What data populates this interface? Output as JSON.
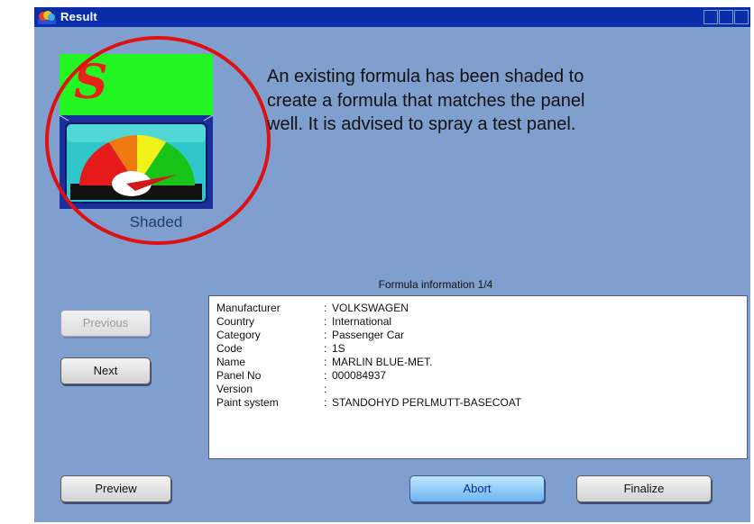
{
  "window": {
    "title": "Result"
  },
  "status": {
    "letter": "S",
    "label": "Shaded",
    "icon": "shaded-gauge-icon",
    "message": "An existing formula has been shaded to create a formula that matches the panel well. It is advised to spray a test panel."
  },
  "formula": {
    "title": "Formula information 1/4",
    "rows": [
      {
        "key": "Manufacturer",
        "value": "VOLKSWAGEN"
      },
      {
        "key": "Country",
        "value": "International"
      },
      {
        "key": "Category",
        "value": "Passenger Car"
      },
      {
        "key": "Code",
        "value": "1S"
      },
      {
        "key": "Name",
        "value": "MARLIN BLUE-MET."
      },
      {
        "key": "Panel No",
        "value": "000084937"
      },
      {
        "key": "Version",
        "value": ""
      },
      {
        "key": "Paint system",
        "value": "STANDOHYD PERLMUTT-BASECOAT"
      }
    ]
  },
  "buttons": {
    "previous": "Previous",
    "next": "Next",
    "preview": "Preview",
    "abort": "Abort",
    "finalize": "Finalize"
  },
  "colors": {
    "background": "#7f9fcf",
    "titlebar": "#0a2eaa",
    "indicator_green": "#22f522",
    "highlight_circle": "#e01010"
  }
}
